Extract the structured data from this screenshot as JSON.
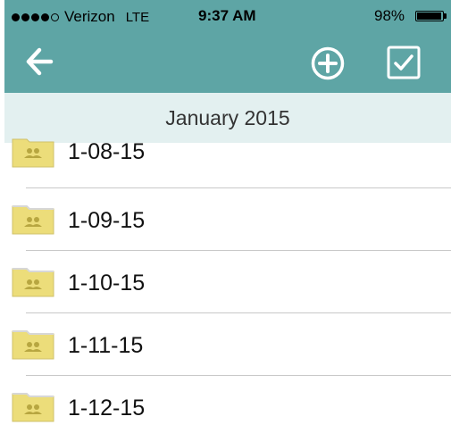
{
  "status_bar": {
    "carrier": "Verizon",
    "network": "LTE",
    "time": "9:37 AM",
    "battery": "98%",
    "signal_bars_filled": 4,
    "signal_bars_total": 5,
    "battery_level": 0.98
  },
  "nav_bar": {
    "back_icon": "arrow-left-icon",
    "add_icon": "plus-circle-icon",
    "select_icon": "checkbox-icon"
  },
  "section": {
    "title": "January 2015"
  },
  "folders": [
    {
      "name": "1-08-15",
      "icon": "shared-folder-icon"
    },
    {
      "name": "1-09-15",
      "icon": "shared-folder-icon"
    },
    {
      "name": "1-10-15",
      "icon": "shared-folder-icon"
    },
    {
      "name": "1-11-15",
      "icon": "shared-folder-icon"
    },
    {
      "name": "1-12-15",
      "icon": "shared-folder-icon"
    }
  ],
  "colors": {
    "nav_bar": "#5ea5a5",
    "section_header": "#e3f0f0",
    "folder": "#ecdd7a",
    "folder_people": "#b7a640"
  }
}
